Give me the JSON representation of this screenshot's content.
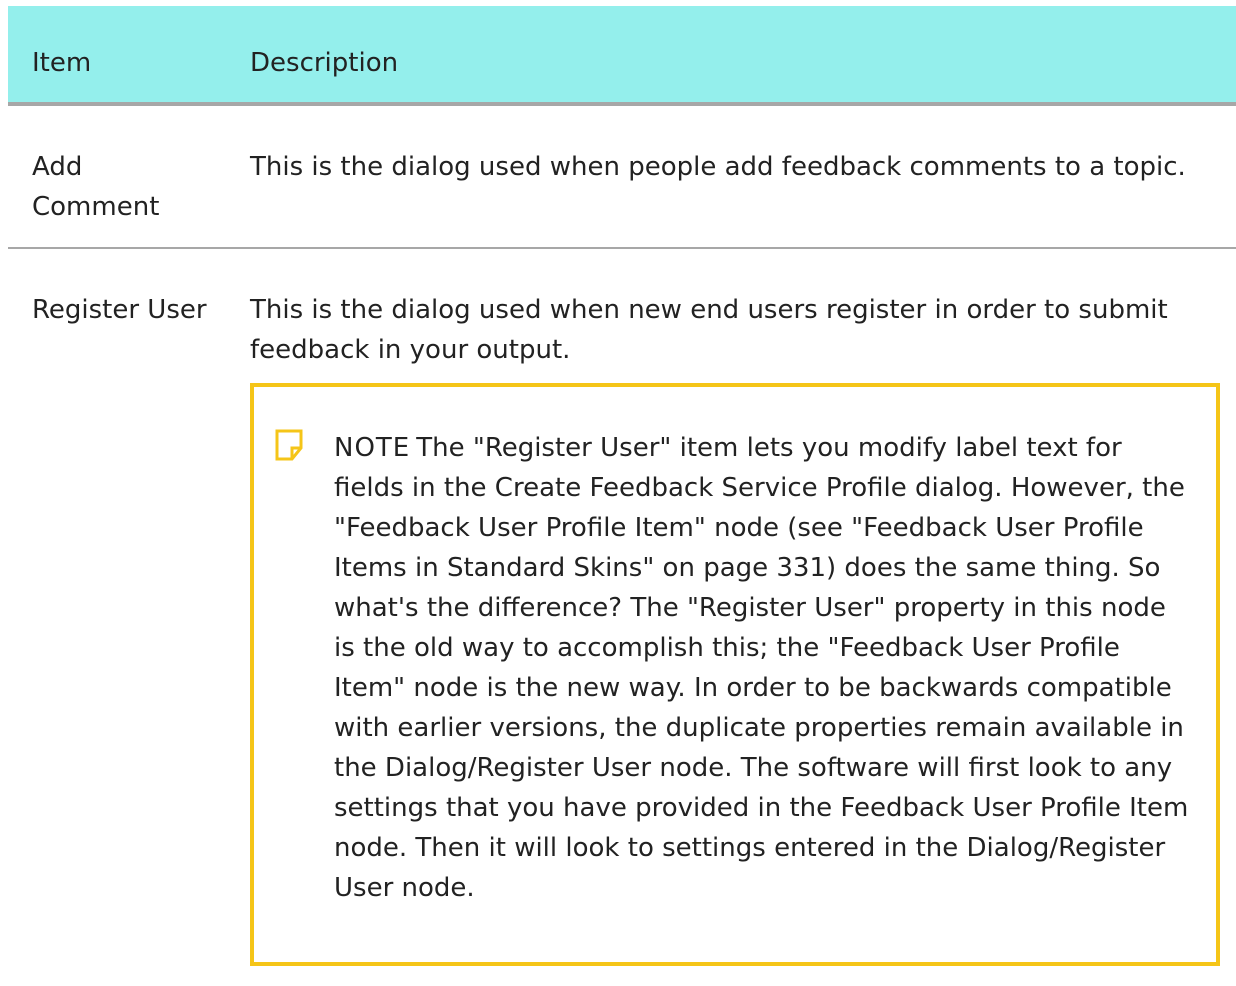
{
  "table": {
    "headers": {
      "item": "Item",
      "description": "Description"
    },
    "rows": [
      {
        "item": "Add Comment",
        "description": "This is the dialog used when people add feedback comments to a topic."
      },
      {
        "item": "Register User",
        "description": "This is the dialog used when new end users register in order to submit feedback in your output.",
        "note": {
          "icon": "note-icon",
          "label": "NOTE",
          "text": "The \"Register User\" item lets you modify label text for fields in the Create Feedback Service Profile dialog. However, the \"Feedback User Profile Item\" node (see \"Feedback User Profile Items in Standard Skins\" on page 331) does the same thing. So what's the difference? The \"Register User\" property in this node is the old way to accomplish this; the \"Feedback User Profile Item\" node is the new way. In order to be backwards compatible with earlier versions, the duplicate properties remain available in the Dialog/Register User node. The software will first look to any settings that you have provided in the Feedback User Profile Item node. Then it will look to settings entered in the Dialog/Register User node."
        }
      }
    ]
  },
  "colors": {
    "header_background": "#94efec",
    "note_border": "#f5c518",
    "divider": "#a7a7a7"
  }
}
